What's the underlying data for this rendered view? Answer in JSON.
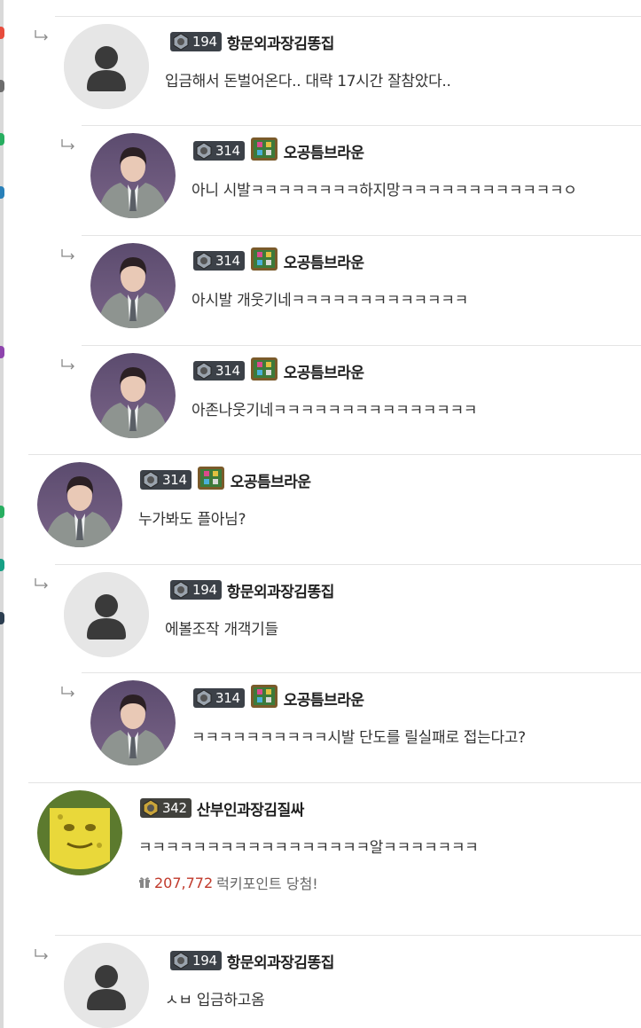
{
  "colors": {
    "divider": "#e4e4e4",
    "level_badge_bg": "#3c4148",
    "lucky_amount": "#c0392b",
    "lucky_text": "#666666"
  },
  "comments": [
    {
      "depth": 1,
      "avatar": "default-user-icon",
      "level": "194",
      "grade_badge": false,
      "nickname": "항문외과장김똥집",
      "text": "입금해서 돈벌어온다.. 대략 17시간 잘참았다.."
    },
    {
      "depth": 2,
      "avatar": "suit-man-photo",
      "level": "314",
      "grade_badge": true,
      "nickname": "오공틈브라운",
      "text": "아니 시발ㅋㅋㅋㅋㅋㅋㅋㅋ하지망ㅋㅋㅋㅋㅋㅋㅋㅋㅋㅋㅋㅋㅇ"
    },
    {
      "depth": 2,
      "avatar": "suit-man-photo",
      "level": "314",
      "grade_badge": true,
      "nickname": "오공틈브라운",
      "text": "아시발 개웃기네ㅋㅋㅋㅋㅋㅋㅋㅋㅋㅋㅋㅋㅋ"
    },
    {
      "depth": 2,
      "avatar": "suit-man-photo",
      "level": "314",
      "grade_badge": true,
      "nickname": "오공틈브라운",
      "text": "아존나웃기네ㅋㅋㅋㅋㅋㅋㅋㅋㅋㅋㅋㅋㅋㅋㅋ"
    },
    {
      "depth": 0,
      "avatar": "suit-man-photo",
      "level": "314",
      "grade_badge": true,
      "nickname": "오공틈브라운",
      "text": "누가봐도 플아님?"
    },
    {
      "depth": 1,
      "avatar": "default-user-icon",
      "level": "194",
      "grade_badge": false,
      "nickname": "항문외과장김똥집",
      "text": "에볼조작 개객기들"
    },
    {
      "depth": 2,
      "avatar": "suit-man-photo",
      "level": "314",
      "grade_badge": true,
      "nickname": "오공틈브라운",
      "text": "ㅋㅋㅋㅋㅋㅋㅋㅋㅋㅋ시발 단도를 릴실패로 접는다고?"
    },
    {
      "depth": -1,
      "avatar": "sponge-cartoon",
      "level": "342",
      "grade_badge": false,
      "gold": true,
      "nickname": "산부인과장김질싸",
      "text": "ㅋㅋㅋㅋㅋㅋㅋㅋㅋㅋㅋㅋㅋㅋㅋㅋㅋ알ㅋㅋㅋㅋㅋㅋㅋ",
      "lucky": {
        "amount": "207,772",
        "label": "럭키포인트 당첨!"
      }
    },
    {
      "depth": 1,
      "avatar": "default-user-icon",
      "level": "194",
      "grade_badge": false,
      "nickname": "항문외과장김똥집",
      "text": "ㅅㅂ 입금하고옴"
    }
  ]
}
